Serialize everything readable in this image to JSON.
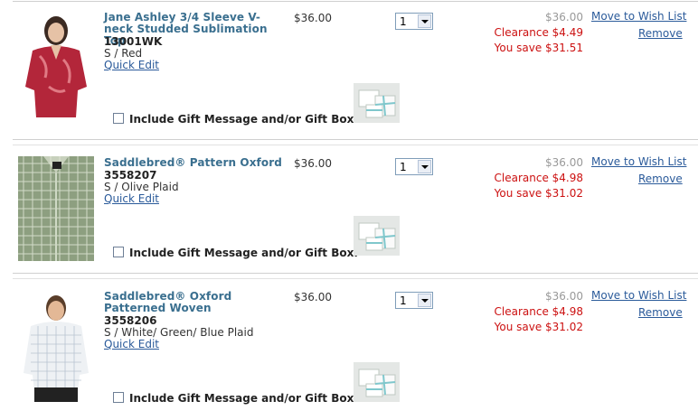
{
  "cart": {
    "items": [
      {
        "name": "Jane Ashley 3/4 Sleeve V-neck Studded Sublimation Top",
        "sku": "13001WK",
        "variant": "S / Red",
        "quick_edit": "Quick Edit",
        "price": "$36.00",
        "quantity": "1",
        "original_price": "$36.00",
        "clearance": "Clearance $4.49",
        "you_save": "You save $31.51",
        "move_to_wishlist": "Move to Wish List",
        "remove": "Remove",
        "gift_label": "Include Gift Message and/or Gift Box.",
        "gift_checked": false
      },
      {
        "name": "Saddlebred® Pattern Oxford",
        "sku": "3558207",
        "variant": "S / Olive Plaid",
        "quick_edit": "Quick Edit",
        "price": "$36.00",
        "quantity": "1",
        "original_price": "$36.00",
        "clearance": "Clearance $4.98",
        "you_save": "You save $31.02",
        "move_to_wishlist": "Move to Wish List",
        "remove": "Remove",
        "gift_label": "Include Gift Message and/or Gift Box.",
        "gift_checked": false
      },
      {
        "name": "Saddlebred® Oxford Patterned Woven",
        "sku": "3558206",
        "variant": "S / White/ Green/ Blue Plaid",
        "quick_edit": "Quick Edit",
        "price": "$36.00",
        "quantity": "1",
        "original_price": "$36.00",
        "clearance": "Clearance $4.98",
        "you_save": "You save $31.02",
        "move_to_wishlist": "Move to Wish List",
        "remove": "Remove",
        "gift_label": "Include Gift Message and/or Gift Box.",
        "gift_checked": false
      }
    ]
  },
  "colors": {
    "link": "#2a5a9a",
    "product_name": "#3a6f8f",
    "clearance_red": "#cc1111",
    "muted": "#999999"
  },
  "icons": {
    "gift_box": "gift-box-icon",
    "dropdown": "chevron-down-icon"
  }
}
